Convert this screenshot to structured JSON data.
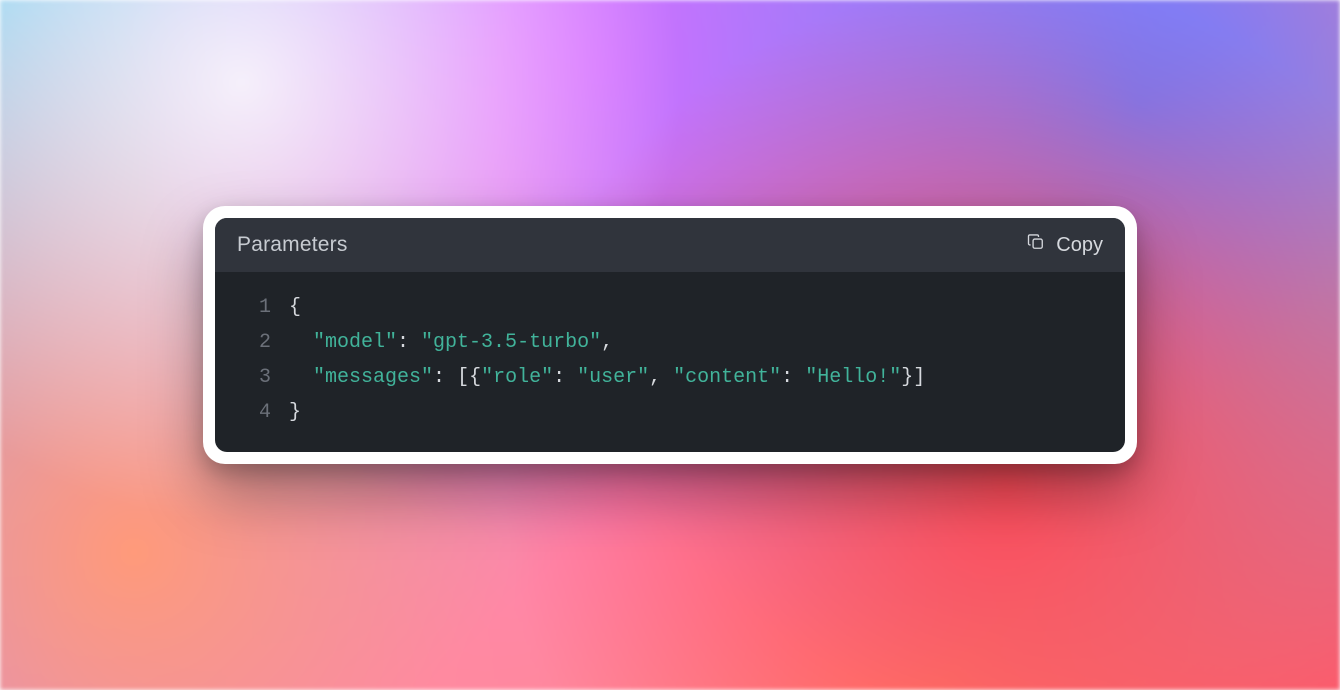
{
  "header": {
    "title": "Parameters",
    "copy_label": "Copy"
  },
  "code": {
    "lines": [
      {
        "num": "1",
        "segments": [
          {
            "cls": "tok-punc",
            "text": "{"
          }
        ]
      },
      {
        "num": "2",
        "segments": [
          {
            "cls": "tok-punc",
            "text": "  "
          },
          {
            "cls": "tok-key",
            "text": "\"model\""
          },
          {
            "cls": "tok-colon",
            "text": ": "
          },
          {
            "cls": "tok-str",
            "text": "\"gpt-3.5-turbo\""
          },
          {
            "cls": "tok-punc",
            "text": ","
          }
        ]
      },
      {
        "num": "3",
        "segments": [
          {
            "cls": "tok-punc",
            "text": "  "
          },
          {
            "cls": "tok-key",
            "text": "\"messages\""
          },
          {
            "cls": "tok-colon",
            "text": ": "
          },
          {
            "cls": "tok-punc",
            "text": "[{"
          },
          {
            "cls": "tok-key",
            "text": "\"role\""
          },
          {
            "cls": "tok-colon",
            "text": ": "
          },
          {
            "cls": "tok-str",
            "text": "\"user\""
          },
          {
            "cls": "tok-punc",
            "text": ", "
          },
          {
            "cls": "tok-key",
            "text": "\"content\""
          },
          {
            "cls": "tok-colon",
            "text": ": "
          },
          {
            "cls": "tok-str",
            "text": "\"Hello!\""
          },
          {
            "cls": "tok-punc",
            "text": "}]"
          }
        ]
      },
      {
        "num": "4",
        "segments": [
          {
            "cls": "tok-punc",
            "text": "}"
          }
        ]
      }
    ]
  }
}
